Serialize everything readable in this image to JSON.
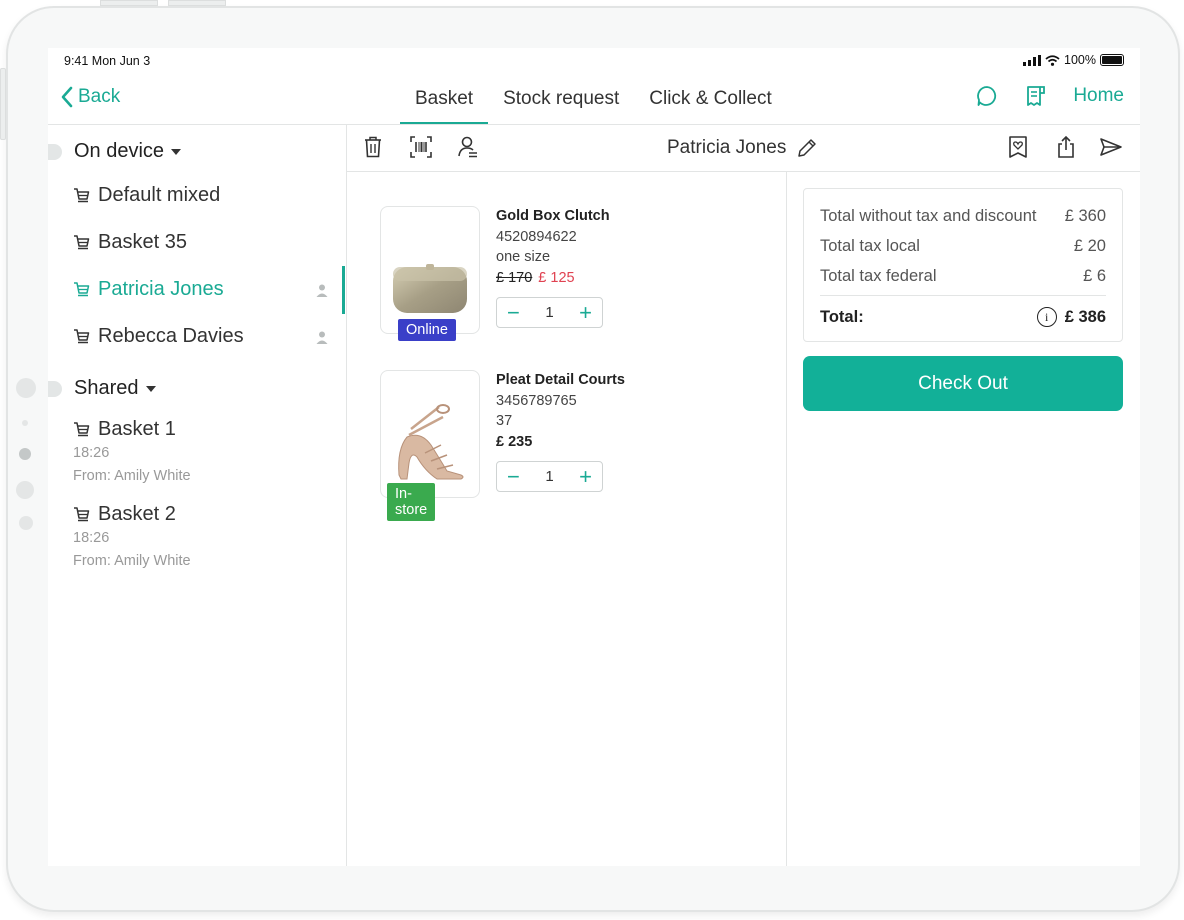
{
  "status": {
    "time": "9:41 Mon Jun 3",
    "battery": "100%"
  },
  "nav": {
    "back_label": "Back",
    "tabs": [
      {
        "label": "Basket",
        "active": true
      },
      {
        "label": "Stock request",
        "active": false
      },
      {
        "label": "Click & Collect",
        "active": false
      }
    ],
    "home_label": "Home"
  },
  "sidebar": {
    "on_device": {
      "heading": "On device",
      "items": [
        {
          "label": "Default mixed",
          "active": false,
          "has_customer": false
        },
        {
          "label": "Basket 35",
          "active": false,
          "has_customer": false
        },
        {
          "label": "Patricia Jones",
          "active": true,
          "has_customer": true
        },
        {
          "label": "Rebecca Davies",
          "active": false,
          "has_customer": true
        }
      ]
    },
    "shared": {
      "heading": "Shared",
      "items": [
        {
          "label": "Basket 1",
          "time": "18:26",
          "from": "From: Amily White"
        },
        {
          "label": "Basket 2",
          "time": "18:26",
          "from": "From: Amily White"
        }
      ]
    }
  },
  "toolbar": {
    "customer_name": "Patricia Jones",
    "icons": [
      "trash-icon",
      "barcode-scan-icon",
      "customer-icon",
      "edit-icon",
      "wishlist-icon",
      "share-icon",
      "send-icon"
    ]
  },
  "products": [
    {
      "name": "Gold Box Clutch",
      "sku": "4520894622",
      "size": "one size",
      "old_price": "£ 170",
      "price": "£ 125",
      "quantity": "1",
      "badge": "Online",
      "badge_color": "#3a3fc8"
    },
    {
      "name": "Pleat Detail Courts",
      "sku": "3456789765",
      "size": "37",
      "price": "£ 235",
      "quantity": "1",
      "badge": "In-store",
      "badge_color": "#3aaa4e"
    }
  ],
  "summary": {
    "rows": [
      {
        "label": "Total without tax and discount",
        "value": "£ 360"
      },
      {
        "label": "Total tax local",
        "value": "£ 20"
      },
      {
        "label": "Total tax federal",
        "value": "£ 6"
      }
    ],
    "total_label": "Total:",
    "total_value": "£ 386"
  },
  "checkout_label": "Check Out",
  "colors": {
    "accent": "#1aaa94",
    "checkout": "#12b098",
    "sale": "#e04251"
  }
}
